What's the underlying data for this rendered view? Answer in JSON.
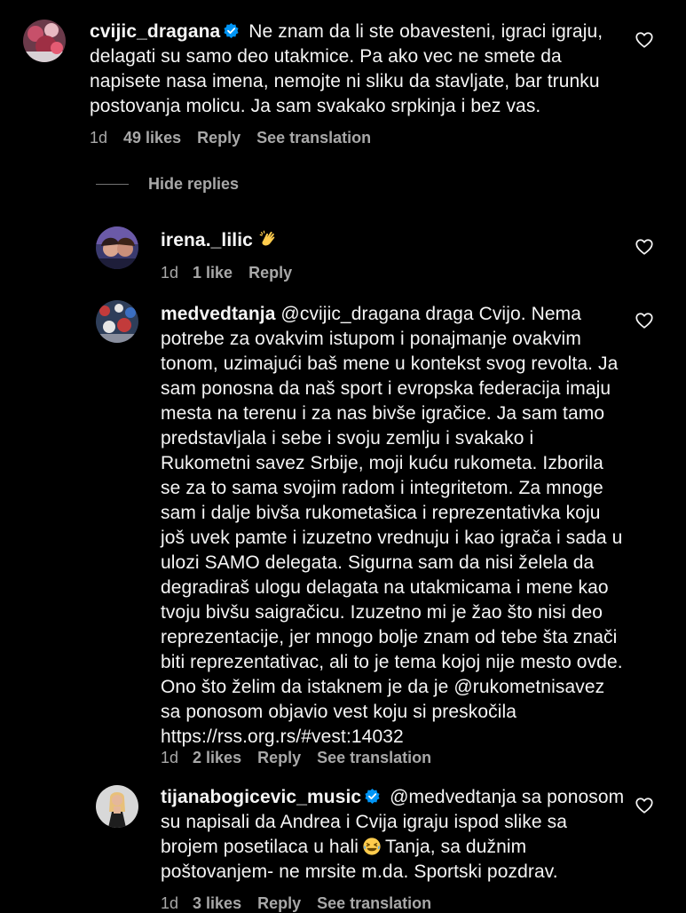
{
  "comments": [
    {
      "username": "cvijic_dragana",
      "verified": true,
      "text": "Ne znam da li ste obavesteni, igraci igraju, delagati su samo deo utakmice. Pa ako vec ne smete da napisete nasa imena, nemojte ni sliku da stavljate, bar trunku postovanja molicu. Ja sam svakako srpkinja i bez vas.",
      "time": "1d",
      "likes": "49 likes",
      "reply": "Reply",
      "translate": "See translation"
    }
  ],
  "hide_replies": "Hide replies",
  "replies": [
    {
      "username": "irena._lilic",
      "emoji": "clapping-hands",
      "time": "1d",
      "likes": "1 like",
      "reply": "Reply"
    },
    {
      "username": "medvedtanja",
      "mention": "@cvijic_dragana",
      "text": "draga Cvijo. Nema potrebe za ovakvim istupom i ponajmanje ovakvim tonom, uzimajući baš mene u kontekst svog revolta. Ja sam ponosna da naš sport i evropska federacija imaju mesta na terenu i za nas bivše igračice. Ja sam tamo predstavljala i sebe i svoju zemlju i svakako i Rukometni savez Srbije, moji kuću rukometa. Izborila se za to sama svojim radom i integritetom. Za mnoge sam i dalje bivša rukometašica i reprezentativka koju još uvek pamte i izuzetno vrednuju i kao igrača i sada u ulozi SAMO delegata. Sigurna sam da nisi želela da degradiraš ulogu delagata na utakmicama i mene kao tvoju bivšu saigračicu. Izuzetno mi je žao što nisi deo reprezentacije, jer mnogo bolje znam od tebe šta znači biti reprezentativac, ali to je tema kojoj nije mesto ovde. Ono što želim da istaknem je da je",
      "mention2": "@rukometnisavez",
      "text2": "sa ponosom objavio vest koju si preskočila",
      "link": "https://rss.org.rs/#vest:14032",
      "time": "1d",
      "likes": "2 likes",
      "reply": "Reply",
      "translate": "See translation"
    },
    {
      "username": "tijanabogicevic_music",
      "verified": true,
      "mention": "@medvedtanja",
      "text": "sa ponosom su napisali da Andrea i Cvija igraju ispod slike sa brojem posetilaca u hali",
      "emoji": "laughing-face",
      "text2": "Tanja, sa dužnim poštovanjem- ne mrsite m.da. Sportski pozdrav.",
      "time": "1d",
      "likes": "3 likes",
      "reply": "Reply",
      "translate": "See translation"
    }
  ],
  "colors": {
    "background": "#000000",
    "text": "#f5f5f5",
    "secondary": "#a8a8a8",
    "verified": "#0095f6"
  }
}
